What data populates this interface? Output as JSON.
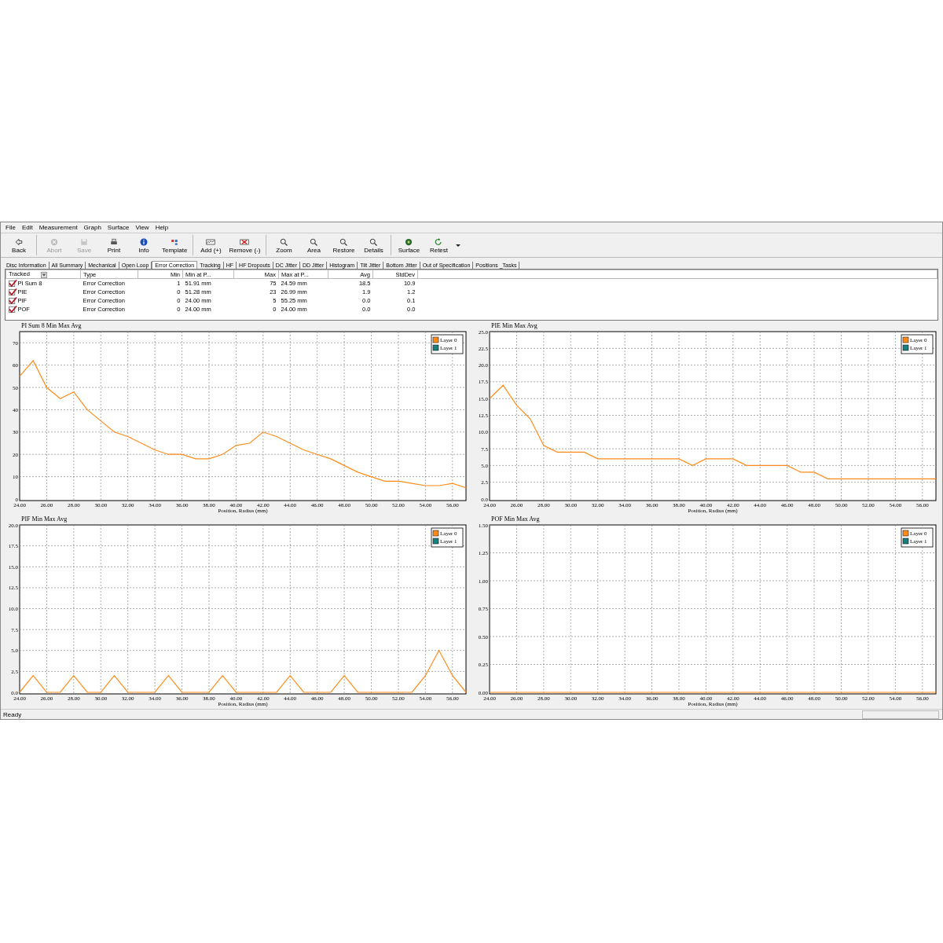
{
  "menu": [
    "File",
    "Edit",
    "Measurement",
    "Graph",
    "Surface",
    "View",
    "Help"
  ],
  "toolbar": [
    {
      "label": "Back",
      "disabled": false
    },
    {
      "label": "Abort",
      "disabled": true
    },
    {
      "label": "Save",
      "disabled": true
    },
    {
      "label": "Print",
      "disabled": false
    },
    {
      "label": "Info",
      "disabled": false
    },
    {
      "label": "Template",
      "disabled": false
    },
    {
      "label": "Add (+)",
      "disabled": false
    },
    {
      "label": "Remove (-)",
      "disabled": false
    },
    {
      "label": "Zoom",
      "disabled": false
    },
    {
      "label": "Area",
      "disabled": false
    },
    {
      "label": "Restore",
      "disabled": false
    },
    {
      "label": "Details",
      "disabled": false
    },
    {
      "label": "Surface",
      "disabled": false
    },
    {
      "label": "Retest",
      "disabled": false
    }
  ],
  "tabs": [
    {
      "label": "Disc Information",
      "selected": false
    },
    {
      "label": "All Summary",
      "selected": false
    },
    {
      "label": "Mechanical",
      "selected": false
    },
    {
      "label": "Open Loop",
      "selected": false
    },
    {
      "label": "Error Correction",
      "selected": true
    },
    {
      "label": "Tracking",
      "selected": false
    },
    {
      "label": "HF",
      "selected": false
    },
    {
      "label": "HF Dropouts",
      "selected": false
    },
    {
      "label": "DC Jitter",
      "selected": false
    },
    {
      "label": "DD Jitter",
      "selected": false
    },
    {
      "label": "Histogram",
      "selected": false
    },
    {
      "label": "Tilt Jitter",
      "selected": false
    },
    {
      "label": "Bottom Jitter",
      "selected": false
    },
    {
      "label": "Out of Specification",
      "selected": false
    },
    {
      "label": "Positions _Tasks",
      "selected": false
    }
  ],
  "table": {
    "columns": [
      "Tracked",
      "Type",
      "Min",
      "Min at P...",
      "Max",
      "Max at P...",
      "Avg",
      "StdDev"
    ],
    "rows": [
      {
        "checked": true,
        "cells": [
          "PI Sum 8",
          "Error Correction",
          "1",
          "51.91 mm",
          "75",
          "24.59 mm",
          "18.5",
          "10.9"
        ]
      },
      {
        "checked": true,
        "cells": [
          "PIE",
          "Error Correction",
          "0",
          "51.28 mm",
          "23",
          "26.99 mm",
          "1.9",
          "1.2"
        ]
      },
      {
        "checked": true,
        "cells": [
          "PIF",
          "Error Correction",
          "0",
          "24.00 mm",
          "5",
          "55.25 mm",
          "0.0",
          "0.1"
        ]
      },
      {
        "checked": true,
        "cells": [
          "POF",
          "Error Correction",
          "0",
          "24.00 mm",
          "0",
          "24.00 mm",
          "0.0",
          "0.0"
        ]
      }
    ]
  },
  "charts": [
    {
      "legend": [
        {
          "label": "Layer 1",
          "color": "#1a7f7f"
        }
      ],
      "chart_data": {
        "type": "line",
        "grid": true,
        "title": "PI Sum 8 Min Max Avg",
        "xlabel": "Position, Radius (mm)",
        "xlim": [
          24,
          57
        ],
        "ylim": [
          0,
          75
        ],
        "x": [
          24,
          25,
          26,
          27,
          28,
          29,
          30,
          31,
          32,
          33,
          34,
          35,
          36,
          37,
          38,
          39,
          40,
          41,
          42,
          43,
          44,
          45,
          46,
          47,
          48,
          49,
          50,
          51,
          52,
          53,
          54,
          55,
          56,
          57
        ],
        "xticks": [
          {
            "value": 24,
            "label": "24.00"
          },
          {
            "value": 26,
            "label": "26.00"
          },
          {
            "value": 28,
            "label": "28.00"
          },
          {
            "value": 30,
            "label": "30.00"
          },
          {
            "value": 32,
            "label": "32.00"
          },
          {
            "value": 34,
            "label": "34.00"
          },
          {
            "value": 36,
            "label": "36.00"
          },
          {
            "value": 38,
            "label": "38.00"
          },
          {
            "value": 40,
            "label": "40.00"
          },
          {
            "value": 42,
            "label": "42.00"
          },
          {
            "value": 44,
            "label": "44.00"
          },
          {
            "value": 46,
            "label": "46.00"
          },
          {
            "value": 48,
            "label": "48.00"
          },
          {
            "value": 50,
            "label": "50.00"
          },
          {
            "value": 52,
            "label": "52.00"
          },
          {
            "value": 54,
            "label": "54.00"
          },
          {
            "value": 56,
            "label": "56.00"
          }
        ],
        "yticks": [
          0,
          10,
          20,
          30,
          40,
          50,
          60,
          70
        ],
        "series": [
          {
            "name": "Layer 0",
            "color": "#ff8c1a",
            "values": [
              55,
              62,
              50,
              45,
              48,
              40,
              35,
              30,
              28,
              25,
              22,
              20,
              20,
              18,
              18,
              20,
              24,
              25,
              30,
              28,
              25,
              22,
              20,
              18,
              15,
              12,
              10,
              8,
              8,
              7,
              6,
              6,
              7,
              5
            ]
          }
        ]
      }
    },
    {
      "legend": [
        {
          "label": "Layer 1",
          "color": "#1a7f7f"
        }
      ],
      "chart_data": {
        "type": "line",
        "grid": true,
        "title": "PIE Min Max Avg",
        "xlabel": "Position, Radius (mm)",
        "xlim": [
          24,
          57
        ],
        "ylim": [
          0,
          25
        ],
        "x": [
          24,
          25,
          26,
          27,
          28,
          29,
          30,
          31,
          32,
          33,
          34,
          35,
          36,
          37,
          38,
          39,
          40,
          41,
          42,
          43,
          44,
          45,
          46,
          47,
          48,
          49,
          50,
          51,
          52,
          53,
          54,
          55,
          56,
          57
        ],
        "xticks": [
          {
            "value": 24,
            "label": "24.00"
          },
          {
            "value": 26,
            "label": "26.00"
          },
          {
            "value": 28,
            "label": "28.00"
          },
          {
            "value": 30,
            "label": "30.00"
          },
          {
            "value": 32,
            "label": "32.00"
          },
          {
            "value": 34,
            "label": "34.00"
          },
          {
            "value": 36,
            "label": "36.00"
          },
          {
            "value": 38,
            "label": "38.00"
          },
          {
            "value": 40,
            "label": "40.00"
          },
          {
            "value": 42,
            "label": "42.00"
          },
          {
            "value": 44,
            "label": "44.00"
          },
          {
            "value": 46,
            "label": "46.00"
          },
          {
            "value": 48,
            "label": "48.00"
          },
          {
            "value": 50,
            "label": "50.00"
          },
          {
            "value": 52,
            "label": "52.00"
          },
          {
            "value": 54,
            "label": "54.00"
          },
          {
            "value": 56,
            "label": "56.00"
          }
        ],
        "yticks": [
          {
            "value": 0,
            "label": "0.0"
          },
          {
            "value": 2.5,
            "label": "2.5"
          },
          {
            "value": 5,
            "label": "5.0"
          },
          {
            "value": 7.5,
            "label": "7.5"
          },
          {
            "value": 10,
            "label": "10.0"
          },
          {
            "value": 12.5,
            "label": "12.5"
          },
          {
            "value": 15,
            "label": "15.0"
          },
          {
            "value": 17.5,
            "label": "17.5"
          },
          {
            "value": 20,
            "label": "20.0"
          },
          {
            "value": 22.5,
            "label": "22.5"
          },
          {
            "value": 25,
            "label": "25.0"
          }
        ],
        "series": [
          {
            "name": "Layer 0",
            "color": "#ff8c1a",
            "values": [
              15,
              17,
              14,
              12,
              8,
              7,
              7,
              7,
              6,
              6,
              6,
              6,
              6,
              6,
              6,
              5,
              6,
              6,
              6,
              5,
              5,
              5,
              5,
              4,
              4,
              3,
              3,
              3,
              3,
              3,
              3,
              3,
              3,
              3
            ]
          }
        ]
      }
    },
    {
      "legend": [
        {
          "label": "Layer 1",
          "color": "#1a7f7f"
        }
      ],
      "chart_data": {
        "type": "line",
        "grid": true,
        "title": "PIF Min Max Avg",
        "xlabel": "Position, Radius (mm)",
        "xlim": [
          24,
          57
        ],
        "ylim": [
          0,
          20
        ],
        "x": [
          24,
          25,
          26,
          27,
          28,
          29,
          30,
          31,
          32,
          33,
          34,
          35,
          36,
          37,
          38,
          39,
          40,
          41,
          42,
          43,
          44,
          45,
          46,
          47,
          48,
          49,
          50,
          51,
          52,
          53,
          54,
          55,
          56,
          57
        ],
        "xticks": [
          {
            "value": 24,
            "label": "24.00"
          },
          {
            "value": 26,
            "label": "26.00"
          },
          {
            "value": 28,
            "label": "28.00"
          },
          {
            "value": 30,
            "label": "30.00"
          },
          {
            "value": 32,
            "label": "32.00"
          },
          {
            "value": 34,
            "label": "34.00"
          },
          {
            "value": 36,
            "label": "36.00"
          },
          {
            "value": 38,
            "label": "38.00"
          },
          {
            "value": 40,
            "label": "40.00"
          },
          {
            "value": 42,
            "label": "42.00"
          },
          {
            "value": 44,
            "label": "44.00"
          },
          {
            "value": 46,
            "label": "46.00"
          },
          {
            "value": 48,
            "label": "48.00"
          },
          {
            "value": 50,
            "label": "50.00"
          },
          {
            "value": 52,
            "label": "52.00"
          },
          {
            "value": 54,
            "label": "54.00"
          },
          {
            "value": 56,
            "label": "56.00"
          }
        ],
        "yticks": [
          {
            "value": 0,
            "label": "0.0"
          },
          {
            "value": 2.5,
            "label": "2.5"
          },
          {
            "value": 5,
            "label": "5.0"
          },
          {
            "value": 7.5,
            "label": "7.5"
          },
          {
            "value": 10,
            "label": "10.0"
          },
          {
            "value": 12.5,
            "label": "12.5"
          },
          {
            "value": 15,
            "label": "15.0"
          },
          {
            "value": 17.5,
            "label": "17.5"
          },
          {
            "value": 20,
            "label": "20.0"
          }
        ],
        "series": [
          {
            "name": "Layer 0",
            "color": "#ff8c1a",
            "values": [
              0,
              2,
              0,
              0,
              2,
              0,
              0,
              2,
              0,
              0,
              0,
              2,
              0,
              0,
              0,
              2,
              0,
              0,
              0,
              0,
              2,
              0,
              0,
              0,
              2,
              0,
              0,
              0,
              0,
              0,
              2,
              5,
              2,
              0
            ]
          }
        ]
      }
    },
    {
      "legend": [
        {
          "label": "Layer 1",
          "color": "#1a7f7f"
        }
      ],
      "chart_data": {
        "type": "line",
        "grid": true,
        "title": "POF Min Max Avg",
        "xlabel": "Position, Radius (mm)",
        "xlim": [
          24,
          57
        ],
        "ylim": [
          0,
          1.5
        ],
        "x": [
          24,
          25,
          26,
          27,
          28,
          29,
          30,
          31,
          32,
          33,
          34,
          35,
          36,
          37,
          38,
          39,
          40,
          41,
          42,
          43,
          44,
          45,
          46,
          47,
          48,
          49,
          50,
          51,
          52,
          53,
          54,
          55,
          56,
          57
        ],
        "xticks": [
          {
            "value": 24,
            "label": "24.00"
          },
          {
            "value": 26,
            "label": "26.00"
          },
          {
            "value": 28,
            "label": "28.00"
          },
          {
            "value": 30,
            "label": "30.00"
          },
          {
            "value": 32,
            "label": "32.00"
          },
          {
            "value": 34,
            "label": "34.00"
          },
          {
            "value": 36,
            "label": "36.00"
          },
          {
            "value": 38,
            "label": "38.00"
          },
          {
            "value": 40,
            "label": "40.00"
          },
          {
            "value": 42,
            "label": "42.00"
          },
          {
            "value": 44,
            "label": "44.00"
          },
          {
            "value": 46,
            "label": "46.00"
          },
          {
            "value": 48,
            "label": "48.00"
          },
          {
            "value": 50,
            "label": "50.00"
          },
          {
            "value": 52,
            "label": "52.00"
          },
          {
            "value": 54,
            "label": "54.00"
          },
          {
            "value": 56,
            "label": "56.00"
          }
        ],
        "yticks": [
          {
            "value": 0,
            "label": "0.00"
          },
          {
            "value": 0.25,
            "label": "0.25"
          },
          {
            "value": 0.5,
            "label": "0.50"
          },
          {
            "value": 0.75,
            "label": "0.75"
          },
          {
            "value": 1,
            "label": "1.00"
          },
          {
            "value": 1.25,
            "label": "1.25"
          },
          {
            "value": 1.5,
            "label": "1.50"
          }
        ],
        "series": [
          {
            "name": "Layer 0",
            "color": "#ff8c1a",
            "values": [
              0,
              0,
              0,
              0,
              0,
              0,
              0,
              0,
              0,
              0,
              0,
              0,
              0,
              0,
              0,
              0,
              0,
              0,
              0,
              0,
              0,
              0,
              0,
              0,
              0,
              0,
              0,
              0,
              0,
              0,
              0,
              0,
              0,
              0
            ]
          }
        ]
      }
    }
  ],
  "status_bar": "Ready"
}
